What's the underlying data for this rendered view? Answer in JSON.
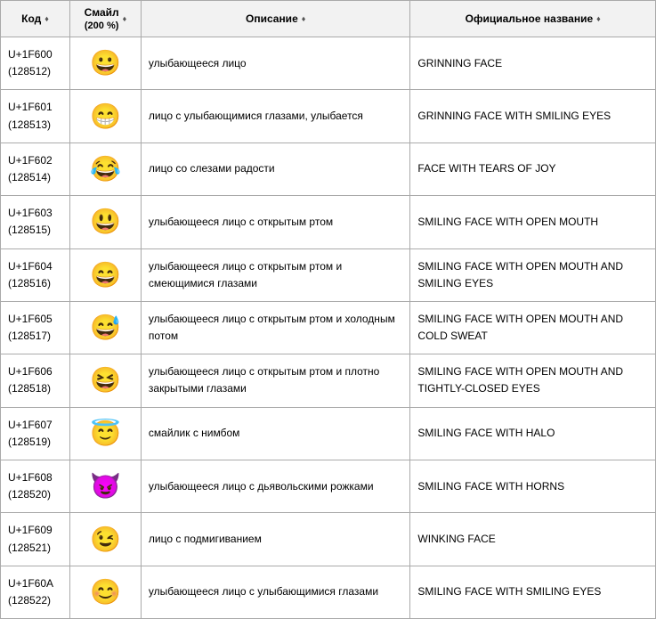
{
  "headers": {
    "code": "Код",
    "emoji": "Смайл",
    "emoji_sub": "(200 %)",
    "description": "Описание",
    "official": "Официальное название"
  },
  "rows": [
    {
      "code": "U+1F600",
      "decimal": "(128512)",
      "emoji": "😀",
      "description": "улыбающееся лицо",
      "official": "GRINNING FACE"
    },
    {
      "code": "U+1F601",
      "decimal": "(128513)",
      "emoji": "😁",
      "description": "лицо с улыбающимися глазами, улыбается",
      "official": "GRINNING FACE WITH SMILING EYES"
    },
    {
      "code": "U+1F602",
      "decimal": "(128514)",
      "emoji": "😂",
      "description": "лицо со слезами радости",
      "official": "FACE WITH TEARS OF JOY"
    },
    {
      "code": "U+1F603",
      "decimal": "(128515)",
      "emoji": "😃",
      "description": "улыбающееся лицо с открытым ртом",
      "official": "SMILING FACE WITH OPEN MOUTH"
    },
    {
      "code": "U+1F604",
      "decimal": "(128516)",
      "emoji": "😄",
      "description": "улыбающееся лицо с открытым ртом и смеющимися глазами",
      "official": "SMILING FACE WITH OPEN MOUTH AND SMILING EYES"
    },
    {
      "code": "U+1F605",
      "decimal": "(128517)",
      "emoji": "😅",
      "description": "улыбающееся лицо с открытым ртом и холодным потом",
      "official": "SMILING FACE WITH OPEN MOUTH AND COLD SWEAT"
    },
    {
      "code": "U+1F606",
      "decimal": "(128518)",
      "emoji": "😆",
      "description": "улыбающееся лицо с открытым ртом и плотно закрытыми глазами",
      "official": "SMILING FACE WITH OPEN MOUTH AND TIGHTLY-CLOSED EYES"
    },
    {
      "code": "U+1F607",
      "decimal": "(128519)",
      "emoji": "😇",
      "description": "смайлик с нимбом",
      "official": "SMILING FACE WITH HALO"
    },
    {
      "code": "U+1F608",
      "decimal": "(128520)",
      "emoji": "😈",
      "description": "улыбающееся лицо с дьявольскими рожками",
      "official": "SMILING FACE WITH HORNS"
    },
    {
      "code": "U+1F609",
      "decimal": "(128521)",
      "emoji": "😉",
      "description": "лицо с подмигиванием",
      "official": "WINKING FACE"
    },
    {
      "code": "U+1F60A",
      "decimal": "(128522)",
      "emoji": "😊",
      "description": "улыбающееся лицо с улыбающимися глазами",
      "official": "SMILING FACE WITH SMILING EYES"
    }
  ]
}
